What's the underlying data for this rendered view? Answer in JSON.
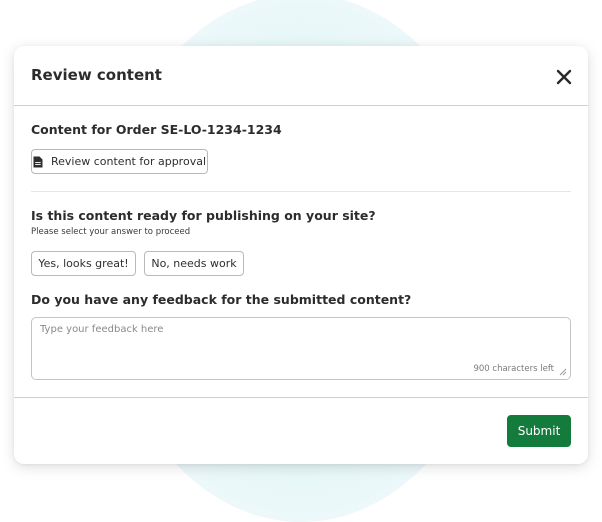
{
  "modal": {
    "title": "Review content",
    "close_icon": "close-icon"
  },
  "content_section": {
    "heading": "Content for Order SE-LO-1234-1234",
    "review_button_label": "Review content for approval",
    "review_button_icon": "document-icon"
  },
  "publish_question": {
    "heading": "Is this content ready for publishing on your site?",
    "subtext": "Please select your answer to proceed",
    "options": [
      "Yes, looks great!",
      "No, needs work"
    ]
  },
  "feedback": {
    "heading": "Do you have any feedback for the submitted content?",
    "placeholder": "Type your feedback here",
    "value": "",
    "chars_left": "900 characters left"
  },
  "footer": {
    "submit_label": "Submit"
  },
  "colors": {
    "primary": "#137c3c",
    "background_blob": "#dff5f0"
  }
}
